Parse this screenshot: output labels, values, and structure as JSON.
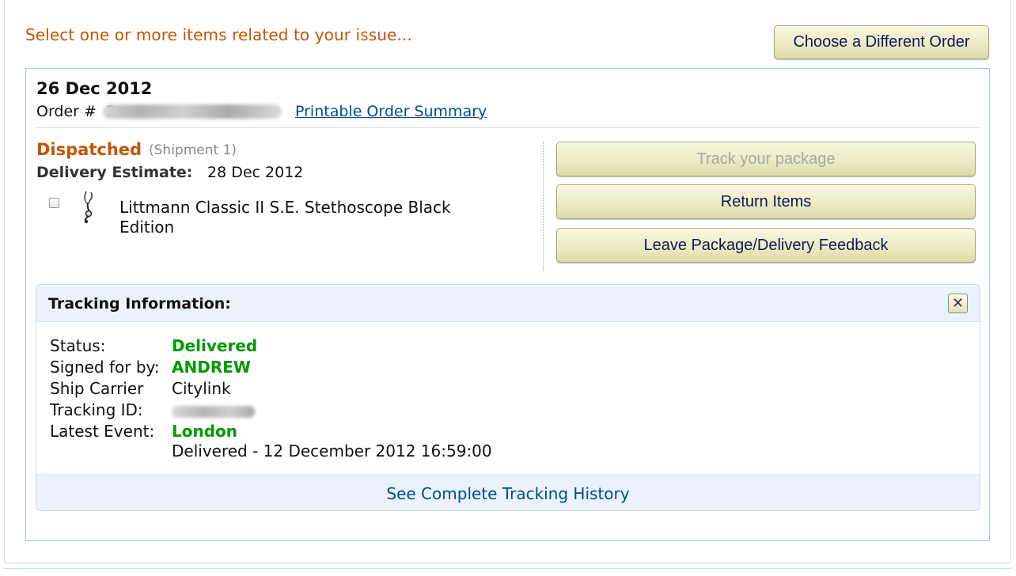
{
  "page": {
    "heading": "Select one or more items related to your issue..."
  },
  "buttons": {
    "choose_order": "Choose a Different Order",
    "track_package": "Track your package",
    "return_items": "Return Items",
    "feedback": "Leave Package/Delivery Feedback"
  },
  "order": {
    "date": "26 Dec 2012",
    "number_label": "Order #",
    "number_value_prefix": "2",
    "summary_link": "Printable Order Summary"
  },
  "shipment": {
    "status": "Dispatched",
    "shipment_label": "(Shipment 1)",
    "delivery_estimate_label": "Delivery Estimate:",
    "delivery_estimate_value": "28 Dec 2012",
    "item": {
      "title": "Littmann Classic II S.E. Stethoscope Black Edition",
      "thumbnail_icon": "stethoscope-icon",
      "selected": false
    }
  },
  "tracking": {
    "title": "Tracking Information:",
    "close_icon": "close-icon",
    "status_label": "Status:",
    "status_value": "Delivered",
    "signed_label": "Signed for by:",
    "signed_value": "ANDREW",
    "carrier_label": "Ship Carrier",
    "carrier_value": "Citylink",
    "tracking_id_label": "Tracking ID:",
    "latest_event_label": "Latest Event:",
    "latest_event_location": "London",
    "latest_event_detail": "Delivered - 12 December 2012 16:59:00",
    "history_link": "See Complete Tracking History"
  },
  "colors": {
    "accent_orange": "#c45500",
    "link_blue": "#004b91",
    "status_green": "#009900",
    "button_text": "#10195a",
    "panel_bg": "#eaf3fb"
  }
}
